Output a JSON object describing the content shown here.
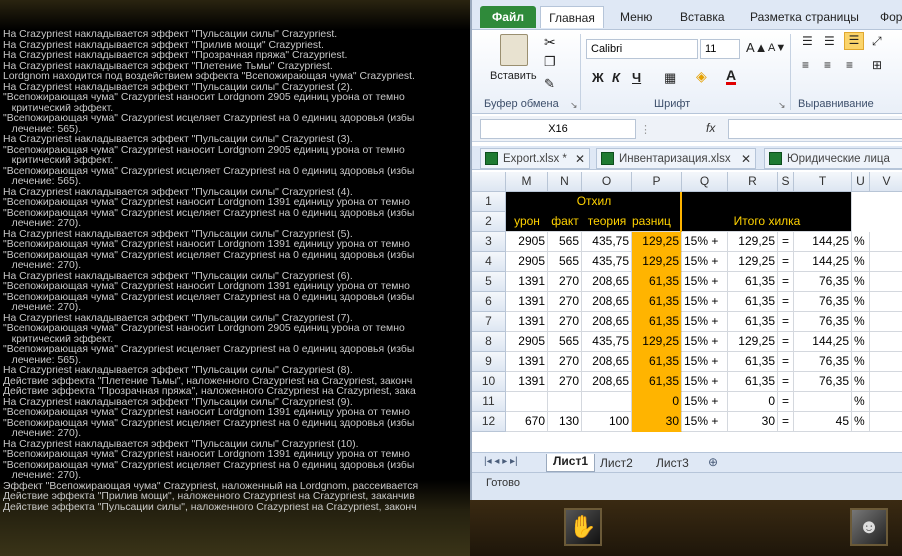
{
  "combat_log": {
    "lines": [
      "На Crazypriest накладывается эффект \"Пульсации силы\" Crazypriest.",
      "На Crazypriest накладывается эффект \"Прилив мощи\" Crazypriest.",
      "На Crazypriest накладывается эффект \"Прозрачная пряжа\" Crazypriest.",
      "На Crazypriest накладывается эффект \"Плетение Тьмы\" Crazypriest.",
      "Lordgnom находится под воздействием эффекта \"Всепожирающая чума\" Crazypriest.",
      "На Crazypriest накладывается эффект \"Пульсации силы\" Crazypriest (2).",
      "\"Всепожирающая чума\" Crazypriest наносит Lordgnom 2905 единиц урона от темно",
      "   критический эффект.",
      "\"Всепожирающая чума\" Crazypriest исцеляет Crazypriest на 0 единиц здоровья (избы",
      "   лечение: 565).",
      "На Crazypriest накладывается эффект \"Пульсации силы\" Crazypriest (3).",
      "\"Всепожирающая чума\" Crazypriest наносит Lordgnom 2905 единиц урона от темно",
      "   критический эффект.",
      "\"Всепожирающая чума\" Crazypriest исцеляет Crazypriest на 0 единиц здоровья (избы",
      "   лечение: 565).",
      "На Crazypriest накладывается эффект \"Пульсации силы\" Crazypriest (4).",
      "\"Всепожирающая чума\" Crazypriest наносит Lordgnom 1391 единицу урона от темно",
      "\"Всепожирающая чума\" Crazypriest исцеляет Crazypriest на 0 единиц здоровья (избы",
      "   лечение: 270).",
      "На Crazypriest накладывается эффект \"Пульсации силы\" Crazypriest (5).",
      "\"Всепожирающая чума\" Crazypriest наносит Lordgnom 1391 единицу урона от темно",
      "\"Всепожирающая чума\" Crazypriest исцеляет Crazypriest на 0 единиц здоровья (избы",
      "   лечение: 270).",
      "На Crazypriest накладывается эффект \"Пульсации силы\" Crazypriest (6).",
      "\"Всепожирающая чума\" Crazypriest наносит Lordgnom 1391 единицу урона от темно",
      "\"Всепожирающая чума\" Crazypriest исцеляет Crazypriest на 0 единиц здоровья (избы",
      "   лечение: 270).",
      "На Crazypriest накладывается эффект \"Пульсации силы\" Crazypriest (7).",
      "\"Всепожирающая чума\" Crazypriest наносит Lordgnom 2905 единиц урона от темно",
      "   критический эффект.",
      "\"Всепожирающая чума\" Crazypriest исцеляет Crazypriest на 0 единиц здоровья (избы",
      "   лечение: 565).",
      "На Crazypriest накладывается эффект \"Пульсации силы\" Crazypriest (8).",
      "Действие эффекта \"Плетение Тьмы\", наложенного Crazypriest на Crazypriest, законч",
      "Действие эффекта \"Прозрачная пряжа\", наложенного Crazypriest на Crazypriest, зака",
      "На Crazypriest накладывается эффект \"Пульсации силы\" Crazypriest (9).",
      "\"Всепожирающая чума\" Crazypriest наносит Lordgnom 1391 единицу урона от темно",
      "\"Всепожирающая чума\" Crazypriest исцеляет Crazypriest на 0 единиц здоровья (избы",
      "   лечение: 270).",
      "На Crazypriest накладывается эффект \"Пульсации силы\" Crazypriest (10).",
      "\"Всепожирающая чума\" Crazypriest наносит Lordgnom 1391 единицу урона от темно",
      "\"Всепожирающая чума\" Crazypriest исцеляет Crazypriest на 0 единиц здоровья (избы",
      "   лечение: 270).",
      "Эффект \"Всепожирающая чума\" Crazypriest, наложенный на Lordgnom, рассеивается",
      "Действие эффекта \"Прилив мощи\", наложенного Crazypriest на Crazypriest, заканчив",
      "Действие эффекта \"Пульсации силы\", наложенного Crazypriest на Crazypriest, законч"
    ]
  },
  "excel": {
    "tabs": {
      "file": "Файл",
      "home": "Главная",
      "menu": "Меню",
      "insert": "Вставка",
      "layout": "Разметка страницы",
      "formulas": "Фор"
    },
    "ribbon": {
      "paste": "Вставить",
      "clipboard": "Буфер обмена",
      "font_group": "Шрифт",
      "align_group": "Выравнивание",
      "font_name": "Calibri",
      "font_size": "11",
      "bold": "Ж",
      "italic": "К",
      "underline": "Ч"
    },
    "name_box": "X16",
    "fx": "fx",
    "workbooks": [
      "Export.xlsx *",
      "Инвентаризация.xlsx",
      "Юридические лица"
    ],
    "columns": [
      "M",
      "N",
      "O",
      "P",
      "Q",
      "R",
      "S",
      "T",
      "U",
      "V"
    ],
    "rows": [
      "1",
      "2",
      "3",
      "4",
      "5",
      "6",
      "7",
      "8",
      "9",
      "10",
      "11",
      "12"
    ],
    "header_row1": "Отхил",
    "header_row2": [
      "урон",
      "факт",
      "теория",
      "разниц"
    ],
    "total_label": "Итого хилка",
    "data": [
      [
        "2905",
        "565",
        "435,75",
        "129,25",
        "15% +",
        "129,25",
        "=",
        "144,25",
        "%"
      ],
      [
        "2905",
        "565",
        "435,75",
        "129,25",
        "15% +",
        "129,25",
        "=",
        "144,25",
        "%"
      ],
      [
        "1391",
        "270",
        "208,65",
        "61,35",
        "15% +",
        "61,35",
        "=",
        "76,35",
        "%"
      ],
      [
        "1391",
        "270",
        "208,65",
        "61,35",
        "15% +",
        "61,35",
        "=",
        "76,35",
        "%"
      ],
      [
        "1391",
        "270",
        "208,65",
        "61,35",
        "15% +",
        "61,35",
        "=",
        "76,35",
        "%"
      ],
      [
        "2905",
        "565",
        "435,75",
        "129,25",
        "15% +",
        "129,25",
        "=",
        "144,25",
        "%"
      ],
      [
        "1391",
        "270",
        "208,65",
        "61,35",
        "15% +",
        "61,35",
        "=",
        "76,35",
        "%"
      ],
      [
        "1391",
        "270",
        "208,65",
        "61,35",
        "15% +",
        "61,35",
        "=",
        "76,35",
        "%"
      ],
      [
        "",
        "",
        "",
        "0",
        "15% +",
        "0",
        "=",
        "",
        "%"
      ],
      [
        "670",
        "130",
        "100",
        "30",
        "15% +",
        "30",
        "=",
        "45",
        "%"
      ]
    ],
    "sheets": [
      "Лист1",
      "Лист2",
      "Лист3"
    ],
    "status": "Готово",
    "colors": {
      "highlight": "#ffb400",
      "header_black": "#000000",
      "header_text": "#ffd200"
    }
  }
}
